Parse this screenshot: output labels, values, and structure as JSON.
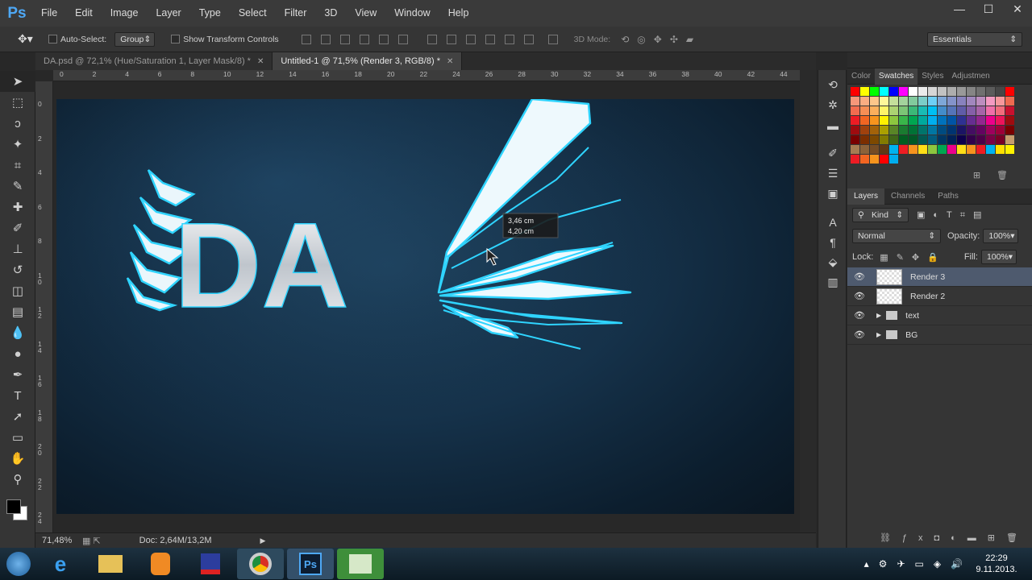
{
  "app": {
    "logo": "Ps"
  },
  "menu": [
    "File",
    "Edit",
    "Image",
    "Layer",
    "Type",
    "Select",
    "Filter",
    "3D",
    "View",
    "Window",
    "Help"
  ],
  "window_controls": {
    "minimize": "—",
    "maximize": "☐",
    "close": "✕"
  },
  "options": {
    "auto_select_label": "Auto-Select:",
    "group_value": "Group",
    "transform_label": "Show Transform Controls",
    "mode3d_label": "3D Mode:",
    "workspace": "Essentials"
  },
  "tabs": [
    {
      "label": "DA.psd @ 72,1% (Hue/Saturation 1, Layer Mask/8) *",
      "close": "✕"
    },
    {
      "label": "Untitled-1 @ 71,5% (Render 3, RGB/8) *",
      "close": "✕"
    }
  ],
  "ruler_top": [
    "0",
    "2",
    "4",
    "6",
    "8",
    "10",
    "12",
    "14",
    "16",
    "18",
    "20",
    "22",
    "24",
    "26",
    "28",
    "30",
    "32",
    "34",
    "36",
    "38",
    "40",
    "42",
    "44"
  ],
  "ruler_left": [
    "0",
    "2",
    "4",
    "6",
    "8",
    "1 0",
    "1 2",
    "1 4",
    "1 6",
    "1 8",
    "2 0",
    "2 2",
    "2 4"
  ],
  "canvas": {
    "text": "DA",
    "tooltip_w": "3,46 cm",
    "tooltip_h": "4,20 cm"
  },
  "status": {
    "zoom": "71,48%",
    "doc": "Doc: 2,64M/13,2M"
  },
  "panels": {
    "top_tabs": [
      "Color",
      "Swatches",
      "Styles",
      "Adjustmen"
    ],
    "layer_tabs": [
      "Layers",
      "Channels",
      "Paths"
    ],
    "kind": "Kind",
    "blend_mode": "Normal",
    "opacity_label": "Opacity:",
    "opacity": "100%",
    "lock_label": "Lock:",
    "fill_label": "Fill:",
    "fill": "100%"
  },
  "layers": [
    {
      "name": "Render 3",
      "type": "smart"
    },
    {
      "name": "Render 2",
      "type": "smart"
    },
    {
      "name": "text",
      "type": "group"
    },
    {
      "name": "BG",
      "type": "group"
    }
  ],
  "taskbar": {
    "time": "22:29",
    "date": "9.11.2013."
  },
  "colors": {
    "accent_glow": "#2fd4ff",
    "ps_blue": "#4ea8f5",
    "selected_layer": "#4e5a6e"
  }
}
